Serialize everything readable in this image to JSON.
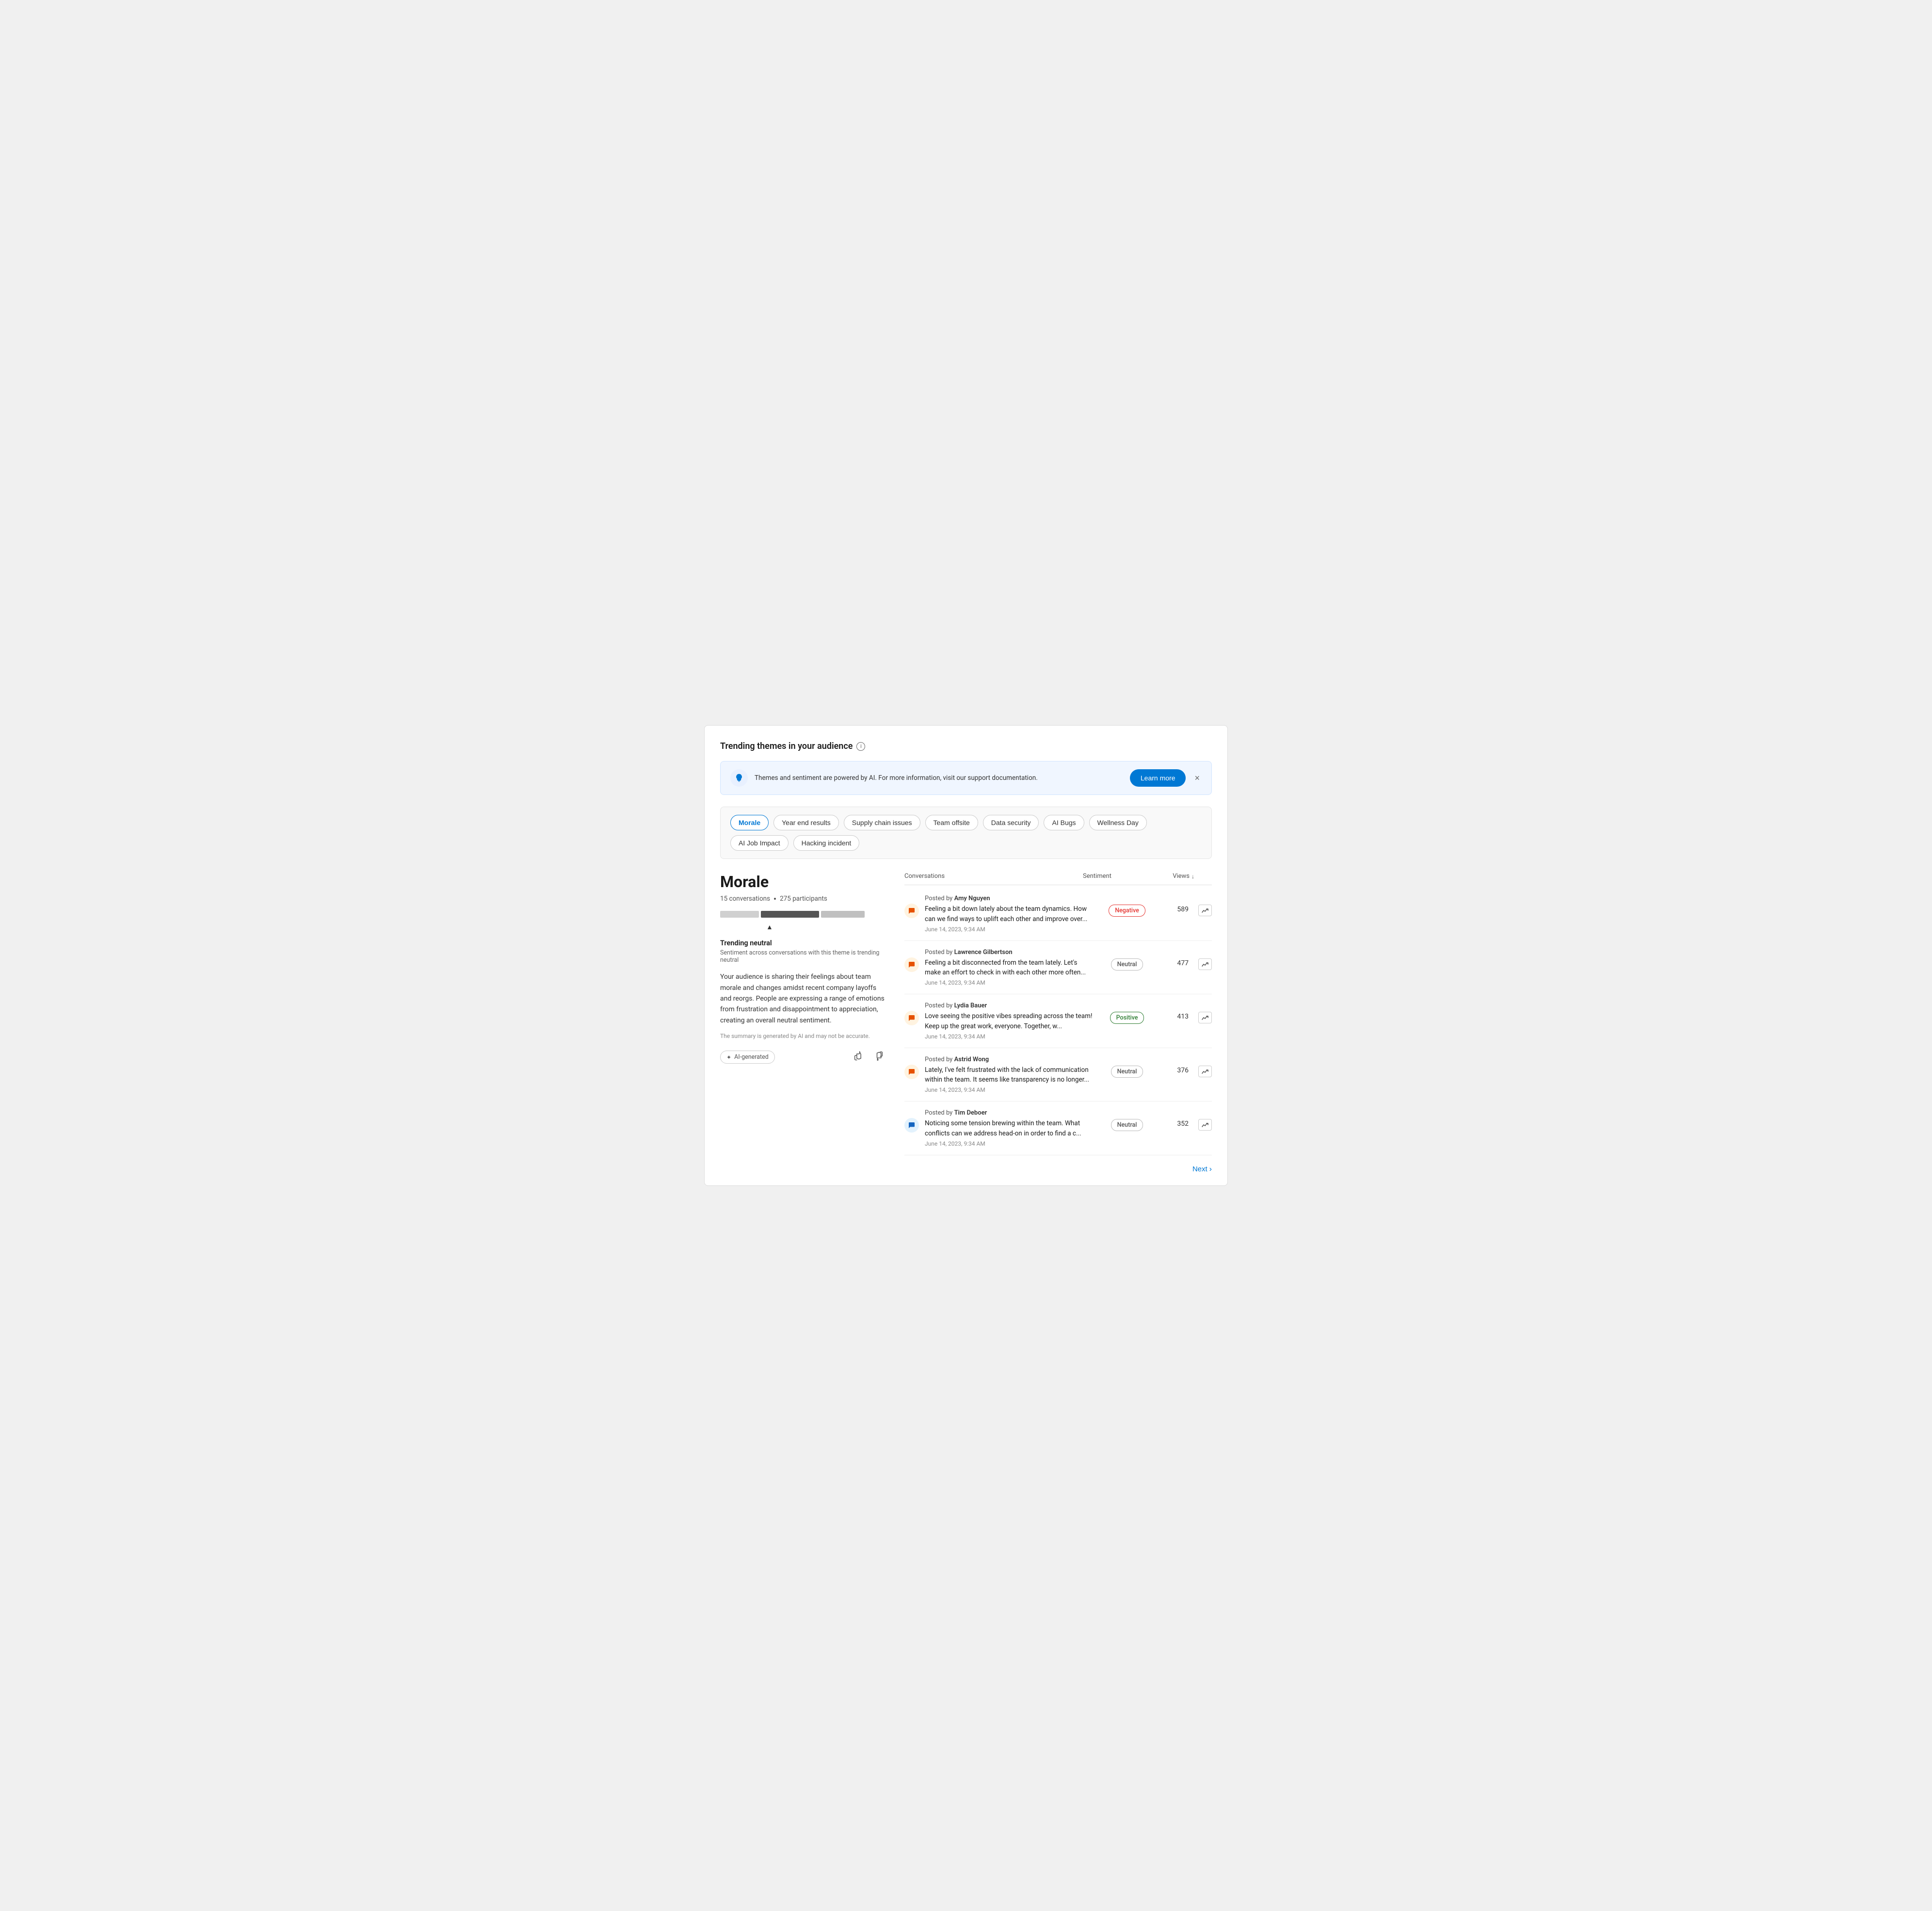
{
  "page": {
    "title": "Trending themes in your audience",
    "info_icon_label": "i"
  },
  "banner": {
    "text": "Themes and sentiment are powered by AI. For more information, visit our support documentation.",
    "learn_more_label": "Learn more",
    "close_label": "×"
  },
  "themes": {
    "tags": [
      {
        "id": "morale",
        "label": "Morale",
        "active": true
      },
      {
        "id": "year-end",
        "label": "Year end results",
        "active": false
      },
      {
        "id": "supply-chain",
        "label": "Supply chain issues",
        "active": false
      },
      {
        "id": "team-offsite",
        "label": "Team offsite",
        "active": false
      },
      {
        "id": "data-security",
        "label": "Data security",
        "active": false
      },
      {
        "id": "ai-bugs",
        "label": "AI Bugs",
        "active": false
      },
      {
        "id": "wellness-day",
        "label": "Wellness Day",
        "active": false
      },
      {
        "id": "ai-job-impact",
        "label": "AI Job Impact",
        "active": false
      },
      {
        "id": "hacking-incident",
        "label": "Hacking incident",
        "active": false
      }
    ]
  },
  "selected_theme": {
    "name": "Morale",
    "conversations_count": "15 conversations",
    "participants_count": "275 participants",
    "trending_title": "Trending neutral",
    "trending_subtitle": "Sentiment across conversations with this theme is trending neutral",
    "description": "Your audience is sharing their feelings about team morale and changes amidst recent company layoffs and reorgs. People are expressing a range of emotions from frustration and disappointment to appreciation, creating an overall neutral sentiment.",
    "disclaimer": "The summary is generated by AI and may not be accurate.",
    "ai_generated_label": "AI-generated",
    "thumbs_up_label": "👍",
    "thumbs_down_label": "👎"
  },
  "table": {
    "col_conversations": "Conversations",
    "col_sentiment": "Sentiment",
    "col_views": "Views",
    "sort_icon": "↓"
  },
  "conversations": [
    {
      "id": 1,
      "author": "Amy Nguyen",
      "posted_by_prefix": "Posted by",
      "text": "Feeling a bit down lately about the team dynamics. How can we find ways to uplift each other and improve over...",
      "date": "June 14, 2023, 9:34 AM",
      "sentiment": "Negative",
      "sentiment_type": "negative",
      "views": "589",
      "icon_type": "orange",
      "icon": "💬"
    },
    {
      "id": 2,
      "author": "Lawrence Gilbertson",
      "posted_by_prefix": "Posted by",
      "text": "Feeling a bit disconnected from the team lately. Let's make an effort to check in with each other more often...",
      "date": "June 14, 2023, 9:34 AM",
      "sentiment": "Neutral",
      "sentiment_type": "neutral",
      "views": "477",
      "icon_type": "orange",
      "icon": "💬"
    },
    {
      "id": 3,
      "author": "Lydia Bauer",
      "posted_by_prefix": "Posted by",
      "text": "Love seeing the positive vibes spreading across the team! Keep up the great work, everyone. Together, w...",
      "date": "June 14, 2023, 9:34 AM",
      "sentiment": "Positive",
      "sentiment_type": "positive",
      "views": "413",
      "icon_type": "orange",
      "icon": "💬"
    },
    {
      "id": 4,
      "author": "Astrid Wong",
      "posted_by_prefix": "Posted by",
      "text": "Lately, I've felt frustrated with the lack of communication within the team. It seems like transparency is no longer...",
      "date": "June 14, 2023, 9:34 AM",
      "sentiment": "Neutral",
      "sentiment_type": "neutral",
      "views": "376",
      "icon_type": "orange",
      "icon": "💬"
    },
    {
      "id": 5,
      "author": "Tim Deboer",
      "posted_by_prefix": "Posted by",
      "text": "Noticing some tension brewing within the team. What conflicts can we address head-on in order to find a c...",
      "date": "June 14, 2023, 9:34 AM",
      "sentiment": "Neutral",
      "sentiment_type": "neutral",
      "views": "352",
      "icon_type": "blue",
      "icon": "💬"
    }
  ],
  "pagination": {
    "next_label": "Next",
    "next_icon": "›"
  }
}
